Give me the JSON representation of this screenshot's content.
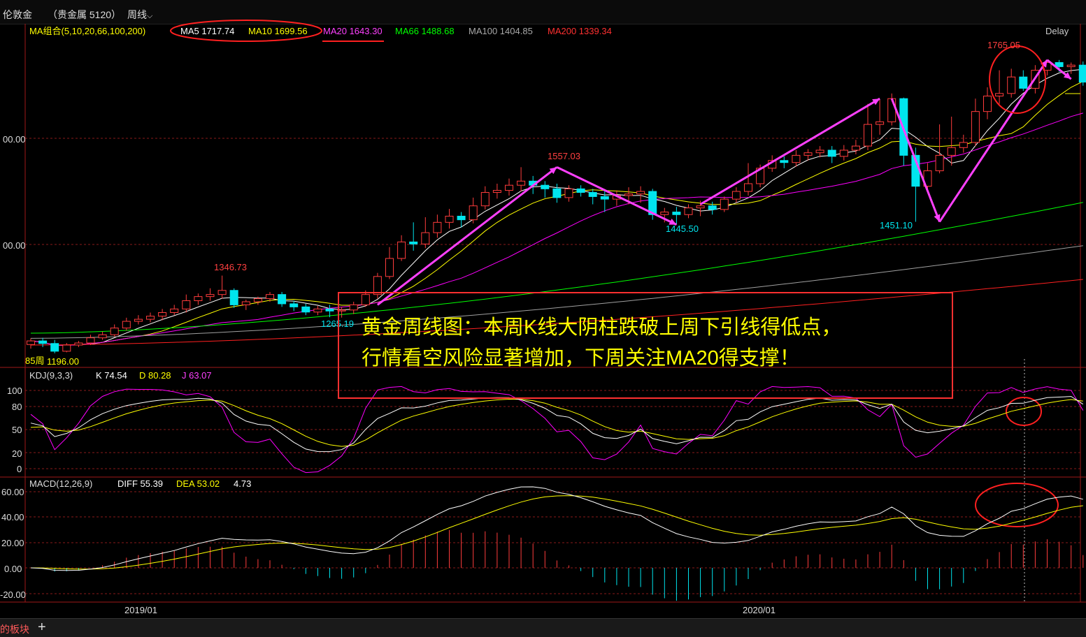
{
  "app": {
    "instrument": "伦敦金",
    "group": "（贵金属 5120）",
    "period": "周线",
    "bottom_tab": "的板块",
    "bottom_add": "+"
  },
  "colors": {
    "up": "#ff3c3c",
    "down": "#00e5ee",
    "ma5": "#ffffff",
    "ma10": "#ffff00",
    "ma20": "#ff00ff",
    "ma66": "#00ff00",
    "ma100": "#a0a0a0",
    "ma200": "#ff2020",
    "annotation": "#ff40ff",
    "callout_box": "#ff3030",
    "callout_text": "#ffff00"
  },
  "price_panel": {
    "legend": {
      "label": "MA组合(5,10,20,66,100,200)",
      "ma5": "MA5 1717.74",
      "ma10": "MA10 1699.56",
      "ma20": "MA20 1643.30",
      "ma66": "MA66 1488.68",
      "ma100": "MA100 1404.85",
      "ma200": "MA200 1339.34"
    },
    "delay": "Delay",
    "y_ticks": [
      "00.00",
      "00.00"
    ],
    "cursor_label": "85周",
    "extreme_labels": [
      {
        "text": "1196.00",
        "x": 1196.0
      },
      {
        "text": "1346.73"
      },
      {
        "text": "1265.19"
      },
      {
        "text": "1557.03"
      },
      {
        "text": "1445.50"
      },
      {
        "text": "1451.10"
      },
      {
        "text": "1765.05"
      }
    ],
    "callout": {
      "line1": "黄金周线图：本周K线大阴柱跌破上周下引线得低点，",
      "line2": "行情看空风险显著增加，下周关注MA20得支撑！"
    }
  },
  "kdj_panel": {
    "label": "KDJ(9,3,3)",
    "k": "K 74.54",
    "d": "D 80.28",
    "j": "J 63.07",
    "y_ticks": [
      "100",
      "80",
      "50",
      "20",
      "0"
    ]
  },
  "macd_panel": {
    "label": "MACD(12,26,9)",
    "diff": "DIFF 55.39",
    "dea": "DEA 53.02",
    "macd": "4.73",
    "y_ticks": [
      "60.00",
      "40.00",
      "20.00",
      "0.00",
      "-20.00"
    ]
  },
  "x_axis": {
    "labels": [
      "2019/01",
      "2020/01"
    ]
  },
  "chart_data": {
    "type": "candlestick",
    "period": "weekly",
    "price_ylim": [
      1170,
      1800
    ],
    "candles": [
      [
        1213,
        1220,
        1205,
        1225
      ],
      [
        1220,
        1215,
        1208,
        1226
      ],
      [
        1215,
        1200,
        1196,
        1222
      ],
      [
        1200,
        1212,
        1198,
        1216
      ],
      [
        1212,
        1216,
        1208,
        1220
      ],
      [
        1216,
        1226,
        1212,
        1232
      ],
      [
        1226,
        1232,
        1222,
        1238
      ],
      [
        1232,
        1245,
        1228,
        1252
      ],
      [
        1245,
        1258,
        1240,
        1265
      ],
      [
        1258,
        1262,
        1252,
        1270
      ],
      [
        1262,
        1268,
        1256,
        1275
      ],
      [
        1268,
        1275,
        1260,
        1282
      ],
      [
        1275,
        1282,
        1270,
        1290
      ],
      [
        1282,
        1298,
        1275,
        1310
      ],
      [
        1298,
        1306,
        1290,
        1312
      ],
      [
        1306,
        1310,
        1298,
        1322
      ],
      [
        1310,
        1318,
        1302,
        1346.73
      ],
      [
        1318,
        1290,
        1284,
        1322
      ],
      [
        1290,
        1296,
        1280,
        1300
      ],
      [
        1296,
        1302,
        1290,
        1306
      ],
      [
        1302,
        1310,
        1296,
        1315
      ],
      [
        1310,
        1292,
        1286,
        1315
      ],
      [
        1292,
        1286,
        1278,
        1298
      ],
      [
        1286,
        1276,
        1270,
        1292
      ],
      [
        1276,
        1282,
        1270,
        1288
      ],
      [
        1282,
        1278,
        1266,
        1290
      ],
      [
        1278,
        1280,
        1265.19,
        1286
      ],
      [
        1280,
        1290,
        1272,
        1296
      ],
      [
        1290,
        1310,
        1286,
        1318
      ],
      [
        1310,
        1345,
        1302,
        1352
      ],
      [
        1345,
        1380,
        1340,
        1402
      ],
      [
        1380,
        1412,
        1375,
        1425
      ],
      [
        1412,
        1408,
        1395,
        1450
      ],
      [
        1408,
        1430,
        1400,
        1460
      ],
      [
        1430,
        1450,
        1420,
        1465
      ],
      [
        1450,
        1462,
        1438,
        1476
      ],
      [
        1462,
        1455,
        1440,
        1470
      ],
      [
        1455,
        1482,
        1448,
        1498
      ],
      [
        1482,
        1508,
        1475,
        1520
      ],
      [
        1508,
        1512,
        1496,
        1525
      ],
      [
        1512,
        1522,
        1502,
        1535
      ],
      [
        1522,
        1530,
        1510,
        1557.03
      ],
      [
        1530,
        1522,
        1505,
        1540
      ],
      [
        1522,
        1515,
        1498,
        1530
      ],
      [
        1515,
        1498,
        1488,
        1525
      ],
      [
        1498,
        1515,
        1490,
        1522
      ],
      [
        1515,
        1508,
        1500,
        1522
      ],
      [
        1508,
        1500,
        1485,
        1515
      ],
      [
        1500,
        1495,
        1470,
        1512
      ],
      [
        1495,
        1502,
        1482,
        1512
      ],
      [
        1502,
        1505,
        1485,
        1518
      ],
      [
        1505,
        1510,
        1488,
        1520
      ],
      [
        1510,
        1465,
        1455,
        1515
      ],
      [
        1465,
        1470,
        1450,
        1478
      ],
      [
        1470,
        1465,
        1445.5,
        1480
      ],
      [
        1465,
        1478,
        1458,
        1485
      ],
      [
        1478,
        1482,
        1462,
        1492
      ],
      [
        1482,
        1475,
        1465,
        1490
      ],
      [
        1475,
        1495,
        1470,
        1500
      ],
      [
        1495,
        1510,
        1488,
        1518
      ],
      [
        1510,
        1525,
        1502,
        1565
      ],
      [
        1525,
        1555,
        1518,
        1562
      ],
      [
        1555,
        1570,
        1548,
        1580
      ],
      [
        1570,
        1566,
        1555,
        1578
      ],
      [
        1566,
        1580,
        1558,
        1590
      ],
      [
        1580,
        1585,
        1570,
        1592
      ],
      [
        1585,
        1590,
        1576,
        1598
      ],
      [
        1590,
        1578,
        1565,
        1598
      ],
      [
        1578,
        1590,
        1570,
        1600
      ],
      [
        1590,
        1598,
        1582,
        1610
      ],
      [
        1598,
        1640,
        1590,
        1680
      ],
      [
        1640,
        1645,
        1620,
        1688
      ],
      [
        1645,
        1690,
        1638,
        1700
      ],
      [
        1690,
        1580,
        1560,
        1692
      ],
      [
        1580,
        1520,
        1451.1,
        1595
      ],
      [
        1520,
        1550,
        1510,
        1565
      ],
      [
        1550,
        1580,
        1545,
        1640
      ],
      [
        1580,
        1595,
        1560,
        1655
      ],
      [
        1595,
        1605,
        1585,
        1620
      ],
      [
        1605,
        1665,
        1598,
        1690
      ],
      [
        1665,
        1695,
        1650,
        1712
      ],
      [
        1695,
        1700,
        1680,
        1745
      ],
      [
        1700,
        1732,
        1692,
        1748
      ],
      [
        1732,
        1710,
        1705,
        1745
      ],
      [
        1710,
        1745,
        1700,
        1755
      ],
      [
        1745,
        1760,
        1735,
        1765.05
      ],
      [
        1760,
        1752,
        1742,
        1765
      ],
      [
        1752,
        1755,
        1738,
        1760
      ],
      [
        1755,
        1722,
        1715,
        1762
      ]
    ],
    "ma": {
      "ma5": 1717.74,
      "ma10": 1699.56,
      "ma20": 1643.3,
      "ma66": 1488.68,
      "ma100": 1404.85,
      "ma200": 1339.34
    },
    "kdj": {
      "k": 74.54,
      "d": 80.28,
      "j": 63.07
    },
    "macd": {
      "diff": 55.39,
      "dea": 53.02,
      "macd": 4.73
    }
  }
}
